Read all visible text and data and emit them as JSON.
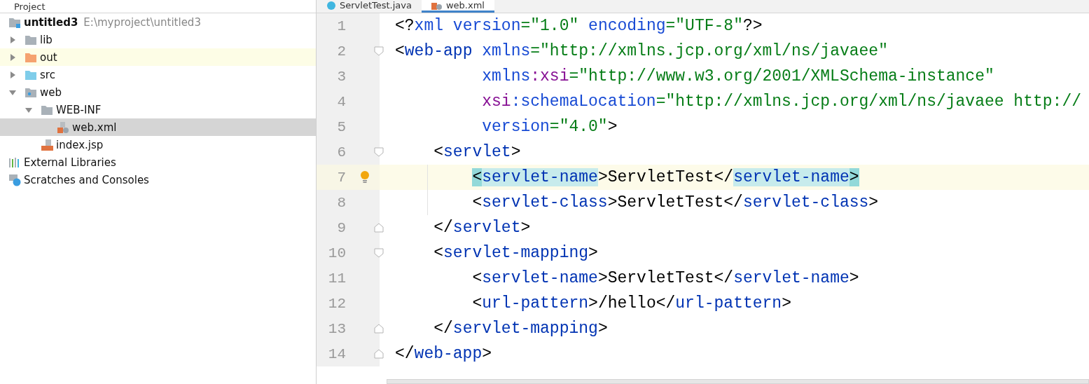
{
  "project_panel": {
    "title": "Project",
    "tree": [
      {
        "label": "untitled3",
        "kind": "module",
        "path": "E:\\myproject\\untitled3",
        "selected": false,
        "highlighted": false,
        "children": [
          {
            "label": "lib",
            "kind": "folder",
            "expanded": false,
            "selected": false,
            "highlighted": false
          },
          {
            "label": "out",
            "kind": "excluded",
            "expanded": false,
            "selected": false,
            "highlighted": true
          },
          {
            "label": "src",
            "kind": "source",
            "expanded": false,
            "selected": false,
            "highlighted": false
          },
          {
            "label": "web",
            "kind": "webroot",
            "expanded": true,
            "selected": false,
            "highlighted": false,
            "children": [
              {
                "label": "WEB-INF",
                "kind": "folder",
                "expanded": true,
                "selected": false,
                "highlighted": false,
                "children": [
                  {
                    "label": "web.xml",
                    "kind": "xml",
                    "selected": true,
                    "highlighted": false
                  }
                ]
              },
              {
                "label": "index.jsp",
                "kind": "jsp",
                "selected": false,
                "highlighted": false
              }
            ]
          }
        ]
      },
      {
        "label": "External Libraries",
        "kind": "libraries",
        "selected": false,
        "highlighted": false
      },
      {
        "label": "Scratches and Consoles",
        "kind": "scratches",
        "selected": false,
        "highlighted": false
      }
    ]
  },
  "tabs": [
    {
      "label": "ServletTest.java",
      "kind": "java",
      "selected": false
    },
    {
      "label": "web.xml",
      "kind": "xml",
      "selected": true
    }
  ],
  "editor": {
    "lines": [
      {
        "number": "1",
        "current": false,
        "bulb": false,
        "fold_start": false,
        "fold_end": false,
        "tokens": [
          {
            "t": "<?",
            "kind": "punct"
          },
          {
            "t": "xml",
            "kind": "attr"
          },
          {
            "t": " version",
            "kind": "attr"
          },
          {
            "t": "=\"1.0\"",
            "kind": "value"
          },
          {
            "t": " encoding",
            "kind": "attr"
          },
          {
            "t": "=\"UTF-8\"",
            "kind": "value"
          },
          {
            "t": "?>",
            "kind": "punct"
          }
        ]
      },
      {
        "number": "2",
        "current": false,
        "bulb": false,
        "fold_start": true,
        "fold_end": false,
        "tokens": [
          {
            "t": "<",
            "kind": "punct"
          },
          {
            "t": "web-app",
            "kind": "tag"
          },
          {
            "t": " xmlns",
            "kind": "attr"
          },
          {
            "t": "=\"http://xmlns.jcp.org/xml/ns/javaee\"",
            "kind": "value"
          }
        ]
      },
      {
        "number": "3",
        "current": false,
        "bulb": false,
        "fold_start": false,
        "fold_end": false,
        "tokens": [
          {
            "t": "         xmlns",
            "kind": "attr"
          },
          {
            "t": ":xsi",
            "kind": "ns"
          },
          {
            "t": "=\"http://www.w3.org/2001/XMLSchema-instance\"",
            "kind": "value"
          }
        ]
      },
      {
        "number": "4",
        "current": false,
        "bulb": false,
        "fold_start": false,
        "fold_end": false,
        "tokens": [
          {
            "t": "         xsi",
            "kind": "ns"
          },
          {
            "t": ":schemaLocation",
            "kind": "attr"
          },
          {
            "t": "=\"http://xmlns.jcp.org/xml/ns/javaee http://",
            "kind": "value"
          }
        ]
      },
      {
        "number": "5",
        "current": false,
        "bulb": false,
        "fold_start": false,
        "fold_end": false,
        "tokens": [
          {
            "t": "         version",
            "kind": "attr"
          },
          {
            "t": "=\"4.0\"",
            "kind": "value"
          },
          {
            "t": ">",
            "kind": "punct"
          }
        ]
      },
      {
        "number": "6",
        "current": false,
        "bulb": false,
        "fold_start": true,
        "fold_end": false,
        "tokens": [
          {
            "t": "    <",
            "kind": "punct"
          },
          {
            "t": "servlet",
            "kind": "tag"
          },
          {
            "t": ">",
            "kind": "punct"
          }
        ]
      },
      {
        "number": "7",
        "current": true,
        "bulb": true,
        "fold_start": false,
        "fold_end": false,
        "tokens": [
          {
            "t": "        <",
            "kind": "punct",
            "match": true
          },
          {
            "t": "servlet-name",
            "kind": "tag",
            "match": true
          },
          {
            "t": ">",
            "kind": "punct",
            "match": false
          },
          {
            "t": "ServletTest",
            "kind": "text",
            "match": false
          },
          {
            "t": "</",
            "kind": "punct",
            "match": false
          },
          {
            "t": "servlet-name",
            "kind": "tag",
            "match": true
          },
          {
            "t": ">",
            "kind": "punct",
            "match": true
          }
        ]
      },
      {
        "number": "8",
        "current": false,
        "bulb": false,
        "fold_start": false,
        "fold_end": false,
        "tokens": [
          {
            "t": "        <",
            "kind": "punct"
          },
          {
            "t": "servlet-class",
            "kind": "tag"
          },
          {
            "t": ">",
            "kind": "punct"
          },
          {
            "t": "ServletTest",
            "kind": "text"
          },
          {
            "t": "</",
            "kind": "punct"
          },
          {
            "t": "servlet-class",
            "kind": "tag"
          },
          {
            "t": ">",
            "kind": "punct"
          }
        ]
      },
      {
        "number": "9",
        "current": false,
        "bulb": false,
        "fold_start": false,
        "fold_end": true,
        "tokens": [
          {
            "t": "    </",
            "kind": "punct"
          },
          {
            "t": "servlet",
            "kind": "tag"
          },
          {
            "t": ">",
            "kind": "punct"
          }
        ]
      },
      {
        "number": "10",
        "current": false,
        "bulb": false,
        "fold_start": true,
        "fold_end": false,
        "tokens": [
          {
            "t": "    <",
            "kind": "punct"
          },
          {
            "t": "servlet-mapping",
            "kind": "tag"
          },
          {
            "t": ">",
            "kind": "punct"
          }
        ]
      },
      {
        "number": "11",
        "current": false,
        "bulb": false,
        "fold_start": false,
        "fold_end": false,
        "tokens": [
          {
            "t": "        <",
            "kind": "punct"
          },
          {
            "t": "servlet-name",
            "kind": "tag"
          },
          {
            "t": ">",
            "kind": "punct"
          },
          {
            "t": "ServletTest",
            "kind": "text"
          },
          {
            "t": "</",
            "kind": "punct"
          },
          {
            "t": "servlet-name",
            "kind": "tag"
          },
          {
            "t": ">",
            "kind": "punct"
          }
        ]
      },
      {
        "number": "12",
        "current": false,
        "bulb": false,
        "fold_start": false,
        "fold_end": false,
        "tokens": [
          {
            "t": "        <",
            "kind": "punct"
          },
          {
            "t": "url-pattern",
            "kind": "tag"
          },
          {
            "t": ">",
            "kind": "punct"
          },
          {
            "t": "/hello",
            "kind": "text"
          },
          {
            "t": "</",
            "kind": "punct"
          },
          {
            "t": "url-pattern",
            "kind": "tag"
          },
          {
            "t": ">",
            "kind": "punct"
          }
        ]
      },
      {
        "number": "13",
        "current": false,
        "bulb": false,
        "fold_start": false,
        "fold_end": true,
        "tokens": [
          {
            "t": "    </",
            "kind": "punct"
          },
          {
            "t": "servlet-mapping",
            "kind": "tag"
          },
          {
            "t": ">",
            "kind": "punct"
          }
        ]
      },
      {
        "number": "14",
        "current": false,
        "bulb": false,
        "fold_start": false,
        "fold_end": true,
        "tokens": [
          {
            "t": "</",
            "kind": "punct"
          },
          {
            "t": "web-app",
            "kind": "tag"
          },
          {
            "t": ">",
            "kind": "punct"
          }
        ]
      }
    ]
  }
}
